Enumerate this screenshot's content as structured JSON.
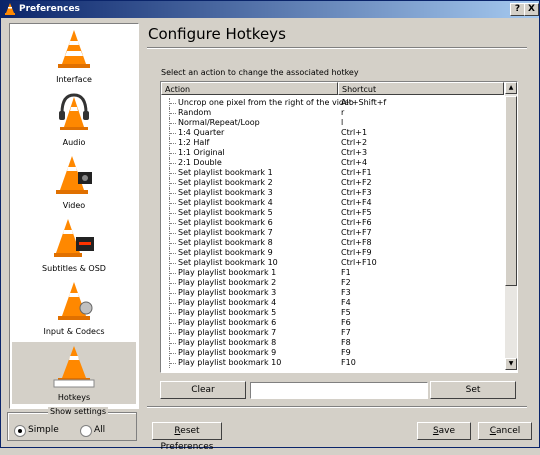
{
  "window": {
    "title": "Preferences",
    "help_btn": "?",
    "close_btn": "X"
  },
  "sidebar": {
    "items": [
      {
        "label": "Interface"
      },
      {
        "label": "Audio"
      },
      {
        "label": "Video"
      },
      {
        "label": "Subtitles & OSD"
      },
      {
        "label": "Input & Codecs"
      },
      {
        "label": "Hotkeys",
        "selected": true
      }
    ]
  },
  "show_settings": {
    "legend": "Show settings",
    "simple": "Simple",
    "all": "All",
    "selected": "Simple"
  },
  "page": {
    "title": "Configure Hotkeys",
    "instruction": "Select an action to change the associated hotkey"
  },
  "table": {
    "columns": [
      "Action",
      "Shortcut"
    ],
    "rows": [
      {
        "action": "Uncrop one pixel from the right of the video",
        "shortcut": "Alt+Shift+f"
      },
      {
        "action": "Random",
        "shortcut": "r"
      },
      {
        "action": "Normal/Repeat/Loop",
        "shortcut": "l"
      },
      {
        "action": "1:4 Quarter",
        "shortcut": "Ctrl+1"
      },
      {
        "action": "1:2 Half",
        "shortcut": "Ctrl+2"
      },
      {
        "action": "1:1 Original",
        "shortcut": "Ctrl+3"
      },
      {
        "action": "2:1 Double",
        "shortcut": "Ctrl+4"
      },
      {
        "action": "Set playlist bookmark 1",
        "shortcut": "Ctrl+F1"
      },
      {
        "action": "Set playlist bookmark 2",
        "shortcut": "Ctrl+F2"
      },
      {
        "action": "Set playlist bookmark 3",
        "shortcut": "Ctrl+F3"
      },
      {
        "action": "Set playlist bookmark 4",
        "shortcut": "Ctrl+F4"
      },
      {
        "action": "Set playlist bookmark 5",
        "shortcut": "Ctrl+F5"
      },
      {
        "action": "Set playlist bookmark 6",
        "shortcut": "Ctrl+F6"
      },
      {
        "action": "Set playlist bookmark 7",
        "shortcut": "Ctrl+F7"
      },
      {
        "action": "Set playlist bookmark 8",
        "shortcut": "Ctrl+F8"
      },
      {
        "action": "Set playlist bookmark 9",
        "shortcut": "Ctrl+F9"
      },
      {
        "action": "Set playlist bookmark 10",
        "shortcut": "Ctrl+F10"
      },
      {
        "action": "Play playlist bookmark 1",
        "shortcut": "F1"
      },
      {
        "action": "Play playlist bookmark 2",
        "shortcut": "F2"
      },
      {
        "action": "Play playlist bookmark 3",
        "shortcut": "F3"
      },
      {
        "action": "Play playlist bookmark 4",
        "shortcut": "F4"
      },
      {
        "action": "Play playlist bookmark 5",
        "shortcut": "F5"
      },
      {
        "action": "Play playlist bookmark 6",
        "shortcut": "F6"
      },
      {
        "action": "Play playlist bookmark 7",
        "shortcut": "F7"
      },
      {
        "action": "Play playlist bookmark 8",
        "shortcut": "F8"
      },
      {
        "action": "Play playlist bookmark 9",
        "shortcut": "F9"
      },
      {
        "action": "Play playlist bookmark 10",
        "shortcut": "F10"
      }
    ]
  },
  "editor": {
    "clear_label": "Clear",
    "hotkey_value": "",
    "set_label": "Set"
  },
  "footer": {
    "reset_label": "Reset Preferences",
    "save_label": "Save",
    "cancel_label": "Cancel"
  },
  "icons": {
    "app": "vlc-cone-icon",
    "scroll_up": "arrow-up-icon",
    "scroll_down": "arrow-down-icon"
  },
  "colors": {
    "titlebar_start": "#0a246a",
    "titlebar_end": "#a6caf0",
    "cone_orange": "#ff8800"
  }
}
